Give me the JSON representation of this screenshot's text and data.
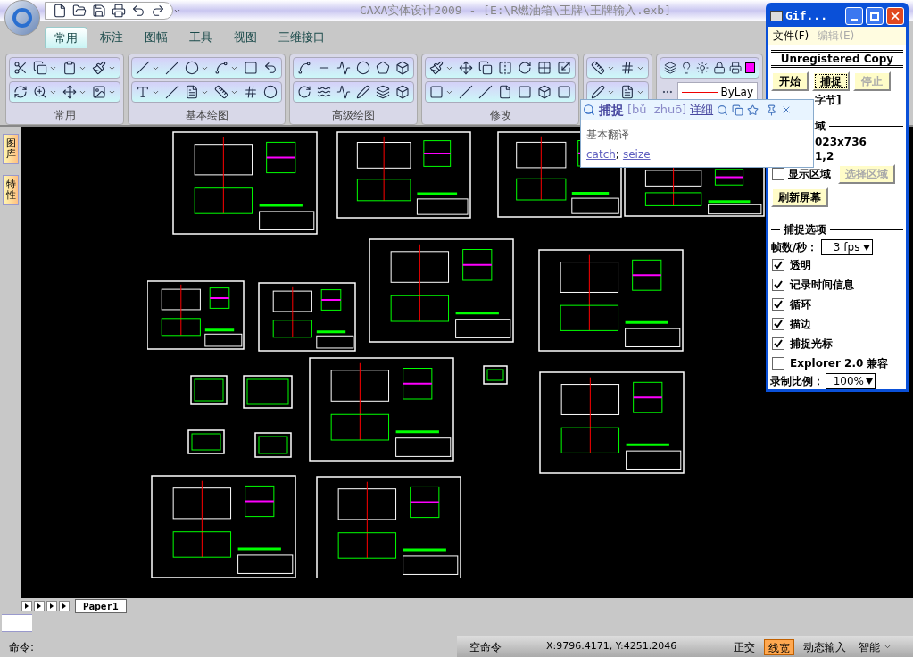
{
  "app": {
    "title": "CAXA实体设计2009 - [E:\\R燃油箱\\王牌\\王牌输入.exb]"
  },
  "ribbon_tabs": [
    {
      "label": "常用",
      "selected": true
    },
    {
      "label": "标注",
      "selected": false
    },
    {
      "label": "图幅",
      "selected": false
    },
    {
      "label": "工具",
      "selected": false
    },
    {
      "label": "视图",
      "selected": false
    },
    {
      "label": "三维接口",
      "selected": false
    }
  ],
  "ribbon_groups": [
    {
      "label": "常用"
    },
    {
      "label": "基本绘图"
    },
    {
      "label": "高级绘图"
    },
    {
      "label": "修改"
    }
  ],
  "properties": {
    "linetype": "ByLay"
  },
  "side_tabs": [
    {
      "label": "图库"
    },
    {
      "label": "特性"
    }
  ],
  "sheet_tabs": [
    {
      "label": "Paper1",
      "selected": true
    }
  ],
  "command": {
    "label": "命令:"
  },
  "status_bar": {
    "prompt": "空命令",
    "coords": "X:9796.4171, Y:4251.2046",
    "toggles": [
      {
        "label": "正交",
        "on": false
      },
      {
        "label": "线宽",
        "on": true
      },
      {
        "label": "动态输入",
        "on": false
      },
      {
        "label": "智能",
        "on": false
      }
    ]
  },
  "dictionary_popup": {
    "word": "捕捉",
    "pinyin": "[bǔ  zhuō]",
    "details_link": "详细",
    "section": "基本翻译",
    "translations": [
      "catch",
      "seize"
    ],
    "separator": ";"
  },
  "gif_window": {
    "title": "Gif...",
    "menu": [
      {
        "label": "文件(F)",
        "disabled": false
      },
      {
        "label": "编辑(E)",
        "disabled": true
      }
    ],
    "banner": "Unregistered Copy",
    "buttons": [
      {
        "label": "开始",
        "disabled": false,
        "focused": false
      },
      {
        "label": "捕捉",
        "disabled": false,
        "focused": true
      },
      {
        "label": "停止",
        "disabled": true,
        "focused": false
      }
    ],
    "partial_lines": [
      "字节]",
      "域",
      "023x736",
      "1,2"
    ],
    "show_area": {
      "label": "显示区域",
      "checked": false
    },
    "select_area_button": {
      "label": "选择区域",
      "disabled": true
    },
    "refresh_button": {
      "label": "刷新屏幕"
    },
    "options_heading": "捕捉选项",
    "fps": {
      "label": "帧数/秒：",
      "value": "3 fps"
    },
    "options": [
      {
        "label": "透明",
        "checked": true
      },
      {
        "label": "记录时间信息",
        "checked": true
      },
      {
        "label": "循环",
        "checked": true
      },
      {
        "label": "描边",
        "checked": true
      },
      {
        "label": "捕捉光标",
        "checked": true
      },
      {
        "label": "Explorer 2.0 兼容",
        "checked": false
      }
    ],
    "scale": {
      "label": "录制比例：",
      "value": "100%"
    }
  }
}
